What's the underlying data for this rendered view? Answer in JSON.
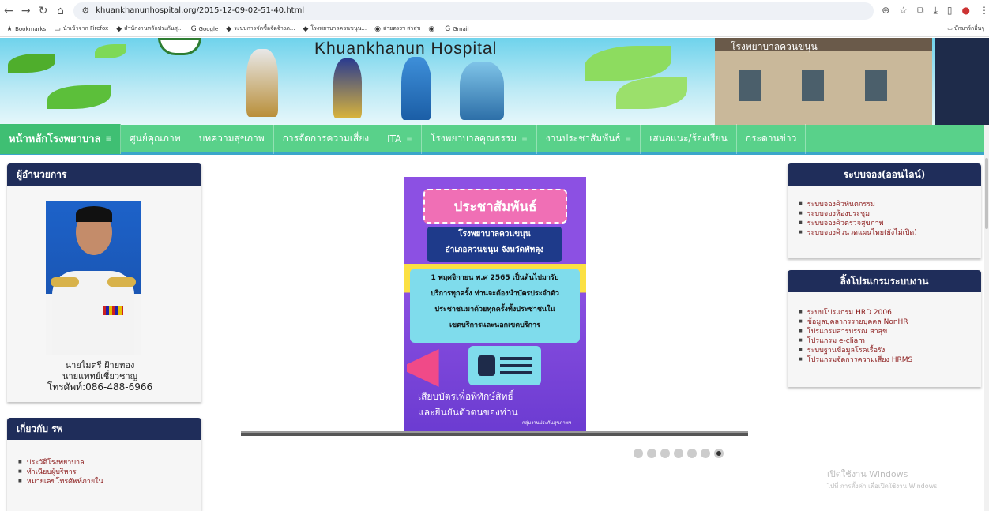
{
  "browser": {
    "url": "khuankhanunhospital.org/2015-12-09-02-51-40.html",
    "bookmarks": [
      {
        "label": "Bookmarks",
        "icon": "star-icon"
      },
      {
        "label": "นำเข้าจาก Firefox",
        "icon": "folder-icon"
      },
      {
        "label": "สำนักงานหลักประกันสุ...",
        "icon": "site-icon"
      },
      {
        "label": "Google",
        "icon": "google-icon"
      },
      {
        "label": "ระบบการจัดซื้อจัดจ้างภ...",
        "icon": "site-icon"
      },
      {
        "label": "โรงพยาบาลควนขนุน...",
        "icon": "site-icon"
      },
      {
        "label": "สายตรงฯ สาสุข",
        "icon": "globe-icon"
      },
      {
        "label": "",
        "icon": "globe-icon"
      },
      {
        "label": "Gmail",
        "icon": "google-icon"
      }
    ],
    "bookmarks_other": "บุ๊กมาร์กอื่นๆ"
  },
  "banner": {
    "title": "Khuankhanun Hospital",
    "building_sign": "โรงพยาบาลควนขนุน"
  },
  "menu": [
    {
      "label": "หน้าหลักโรงพยาบาล",
      "has_dropdown": true
    },
    {
      "label": "ศูนย์คุณภาพ",
      "has_dropdown": false
    },
    {
      "label": "บทความสุขภาพ",
      "has_dropdown": false
    },
    {
      "label": "การจัดการความเสี่ยง",
      "has_dropdown": false
    },
    {
      "label": "ITA",
      "has_dropdown": true
    },
    {
      "label": "โรงพยาบาลคุณธรรม",
      "has_dropdown": true
    },
    {
      "label": "งานประชาสัมพันธ์",
      "has_dropdown": true
    },
    {
      "label": "เสนอแนะ/ร้องเรียน",
      "has_dropdown": false
    },
    {
      "label": "กระดานข่าว",
      "has_dropdown": false
    }
  ],
  "director": {
    "heading": "ผู้อำนวยการ",
    "name": "นายไมตรี ฝ้ายทอง",
    "position": "นายแพทย์เชี่ยวชาญ",
    "phone": "โทรศัพท์:086-488-6966"
  },
  "about": {
    "heading": "เกี่ยวกับ รพ",
    "items": [
      "ประวัติโรงพยาบาล",
      "ทำเนียบผู้บริหาร",
      "หมายเลขโทรศัพท์ภายใน"
    ]
  },
  "booking": {
    "heading": "ระบบจอง(ออนไลน์)",
    "items": [
      "ระบบจองคิวทันตกรรม",
      "ระบบจองห้องประชุม",
      "ระบบจองคิวตรวจสุขภาพ",
      "ระบบจองคิวนวดแผนไทย(ยังไม่เปิด)"
    ]
  },
  "programs": {
    "heading": "ลิ้งโปรแกรมระบบงาน",
    "items": [
      "ระบบโปรแกรม HRD 2006",
      "ข้อมูลบุคลากรรายบุคคล NonHR",
      "โปรแกรมสารบรรณ สาสุข",
      "โปรแกรม e-cliam",
      "ระบบฐานข้อมูลโรคเรื้อรัง",
      "โปรแกรมจัดการความเสี่ยง HRMS"
    ]
  },
  "poster": {
    "title": "ประชาสัมพันธ์",
    "hospital": "โรงพยาบาลควนขนุน",
    "district": "อำเภอควนขนุน จังหวัดพัทลุง",
    "line1": "1 พฤศจิกายน พ.ศ 2565 เป็นต้นไปมารับ",
    "line2": "บริการทุกครั้ง ท่านจะต้องนำบัตรประจำตัว",
    "line3": "ประชาชนมาด้วยทุกครั้งทั้งประชาชนใน",
    "line4": "เขตบริการและนอกเขตบริการ",
    "bottom1": "เสียบบัตรเพื่อพิทักษ์สิทธิ์",
    "bottom2": "และยืนยันตัวตนของท่าน",
    "credit": "กลุ่มงานประกันสุขภาพฯ"
  },
  "slider": {
    "count": 7,
    "active_index": 6
  },
  "windows_watermark": {
    "line1": "เปิดใช้งาน Windows",
    "line2": "ไปที่ การตั้งค่า เพื่อเปิดใช้งาน Windows"
  }
}
